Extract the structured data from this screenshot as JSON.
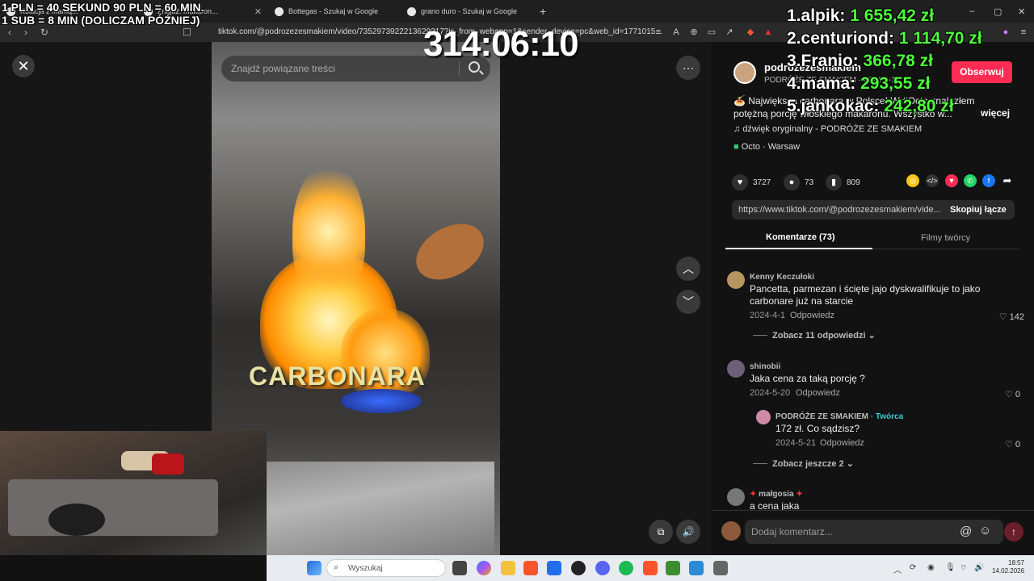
{
  "browser": {
    "tabs": [
      {
        "label": "Kolacja z mamą...",
        "partial": true
      },
      {
        "label": "Znajdź: makaron...",
        "partial": true
      },
      {
        "label": "Bottegas - Szukaj w Google"
      },
      {
        "label": "grano duro - Szukaj w Google"
      }
    ],
    "new_tab": "+",
    "url": "tiktok.com/@podrozezesmakiem/video/7352973922213629217?is_from_webapp=1&sender_device=pc&web_id=1771015...",
    "window_controls": [
      "–",
      "▢",
      "✕"
    ]
  },
  "overlay": {
    "promo_line1": "1 PLN =  40 SEKUND 90 PLN = 60 MIN.",
    "promo_line2": "1 SUB = 8 MIN (DOLICZAM PÓŹNIEJ)",
    "timer": "314:06:10",
    "leaderboard": [
      {
        "rank": "1.",
        "name": "alpik:",
        "amount": "1 655,42 zł"
      },
      {
        "rank": "2.",
        "name": "centuriond:",
        "amount": "1 114,70 zł"
      },
      {
        "rank": "3.",
        "name": "Franio:",
        "amount": "366,78 zł"
      },
      {
        "rank": "4.",
        "name": "mama:",
        "amount": "293,55 zł"
      },
      {
        "rank": "5.",
        "name": "jankokac:",
        "amount": "242,80 zł"
      }
    ]
  },
  "video": {
    "search_placeholder": "Znajdź powiązane treści",
    "caption": "CARBONARA",
    "more_icon": "⋯",
    "up_icon": "︿",
    "down_icon": "﹀"
  },
  "post": {
    "username": "podrozezesmakiem",
    "display_name": "PODRÓŻE ZE SMAKIEM · 2024-4-1",
    "follow": "Obserwuj",
    "description": "🍝 Największa carbonara w Polsce! W #Octo znalazłem potężną porcję włoskiego makaronu. Wszystko w...",
    "more": "więcej",
    "sound": "dźwięk oryginalny - PODRÓŻE ZE SMAKIEM",
    "place": "Octo · Warsaw",
    "likes": "3727",
    "comments": "73",
    "saves": "809",
    "link": "https://www.tiktok.com/@podrozezesmakiem/vide...",
    "copy": "Skopiuj łącze",
    "tab_comments": "Komentarze (73)",
    "tab_creator": "Filmy twórcy"
  },
  "comments": [
    {
      "name": "Kenny Keczułoki",
      "text1": "Pancetta, parmezan i ścięte jajo dyskwalifikuje to jako",
      "text2": "carbonare już na starcie",
      "date": "2024-4-1",
      "reply": "Odpowiedz",
      "likes": "142",
      "more": "Zobacz 11 odpowiedzi"
    },
    {
      "name": "shinobii",
      "text1": "Jaka cena za taką porcję ?",
      "date": "2024-5-20",
      "reply": "Odpowiedz",
      "likes": "0"
    },
    {
      "name": "PODRÓŻE ZE SMAKIEM",
      "creator": "· Twórca",
      "text1": "172 zł. Co sądzisz?",
      "date": "2024-5-21",
      "reply": "Odpowiedz",
      "likes": "0",
      "more": "Zobacz jeszcze 2"
    },
    {
      "name": "małgosia",
      "text1": "a cena jaka"
    }
  ],
  "comment_input": {
    "placeholder": "Dodaj komentarz..."
  },
  "taskbar": {
    "search": "Wyszukaj",
    "time": "18:57",
    "date": "14.02.2026"
  },
  "colors": {
    "accent": "#fe2c55",
    "leader_amount": "#4dff3a"
  }
}
